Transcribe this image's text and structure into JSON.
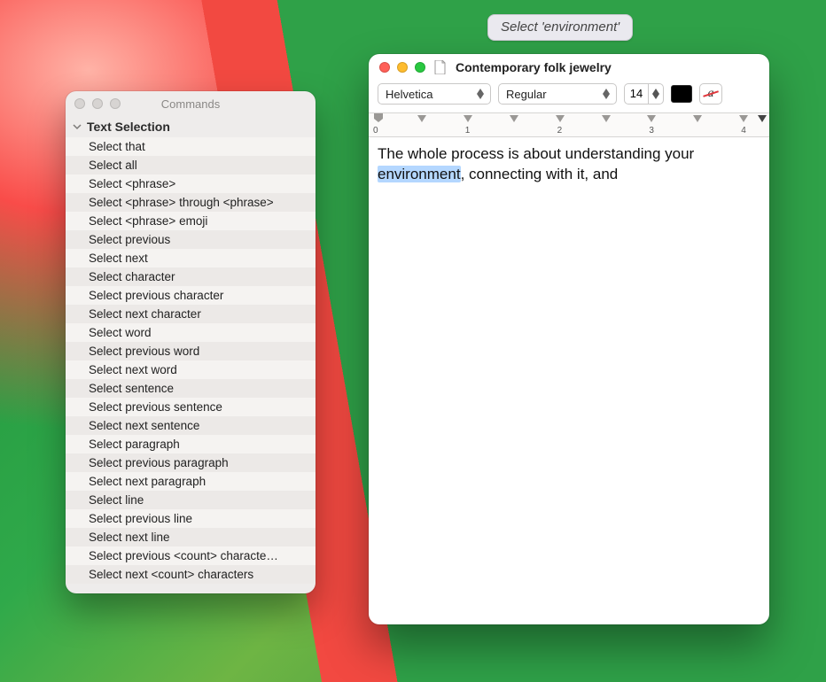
{
  "tooltip": {
    "text": "Select 'environment'"
  },
  "commands_window": {
    "title": "Commands",
    "group_title": "Text Selection",
    "items": [
      "Select that",
      "Select all",
      "Select <phrase>",
      "Select <phrase> through <phrase>",
      "Select <phrase> emoji",
      "Select previous",
      "Select next",
      "Select character",
      "Select previous character",
      "Select next character",
      "Select word",
      "Select previous word",
      "Select next word",
      "Select sentence",
      "Select previous sentence",
      "Select next sentence",
      "Select paragraph",
      "Select previous paragraph",
      "Select next paragraph",
      "Select line",
      "Select previous line",
      "Select next line",
      "Select previous <count> characte…",
      "Select next <count> characters"
    ]
  },
  "textedit_window": {
    "title": "Contemporary folk jewelry",
    "toolbar": {
      "font": "Helvetica",
      "style": "Regular",
      "size": "14",
      "color": "#000000",
      "strike_label": "a"
    },
    "ruler": {
      "labels": [
        "0",
        "1",
        "2",
        "3",
        "4"
      ]
    },
    "document": {
      "before": "The whole process is about understanding your ",
      "highlight": "environment",
      "after": ", connecting with it, and"
    }
  }
}
